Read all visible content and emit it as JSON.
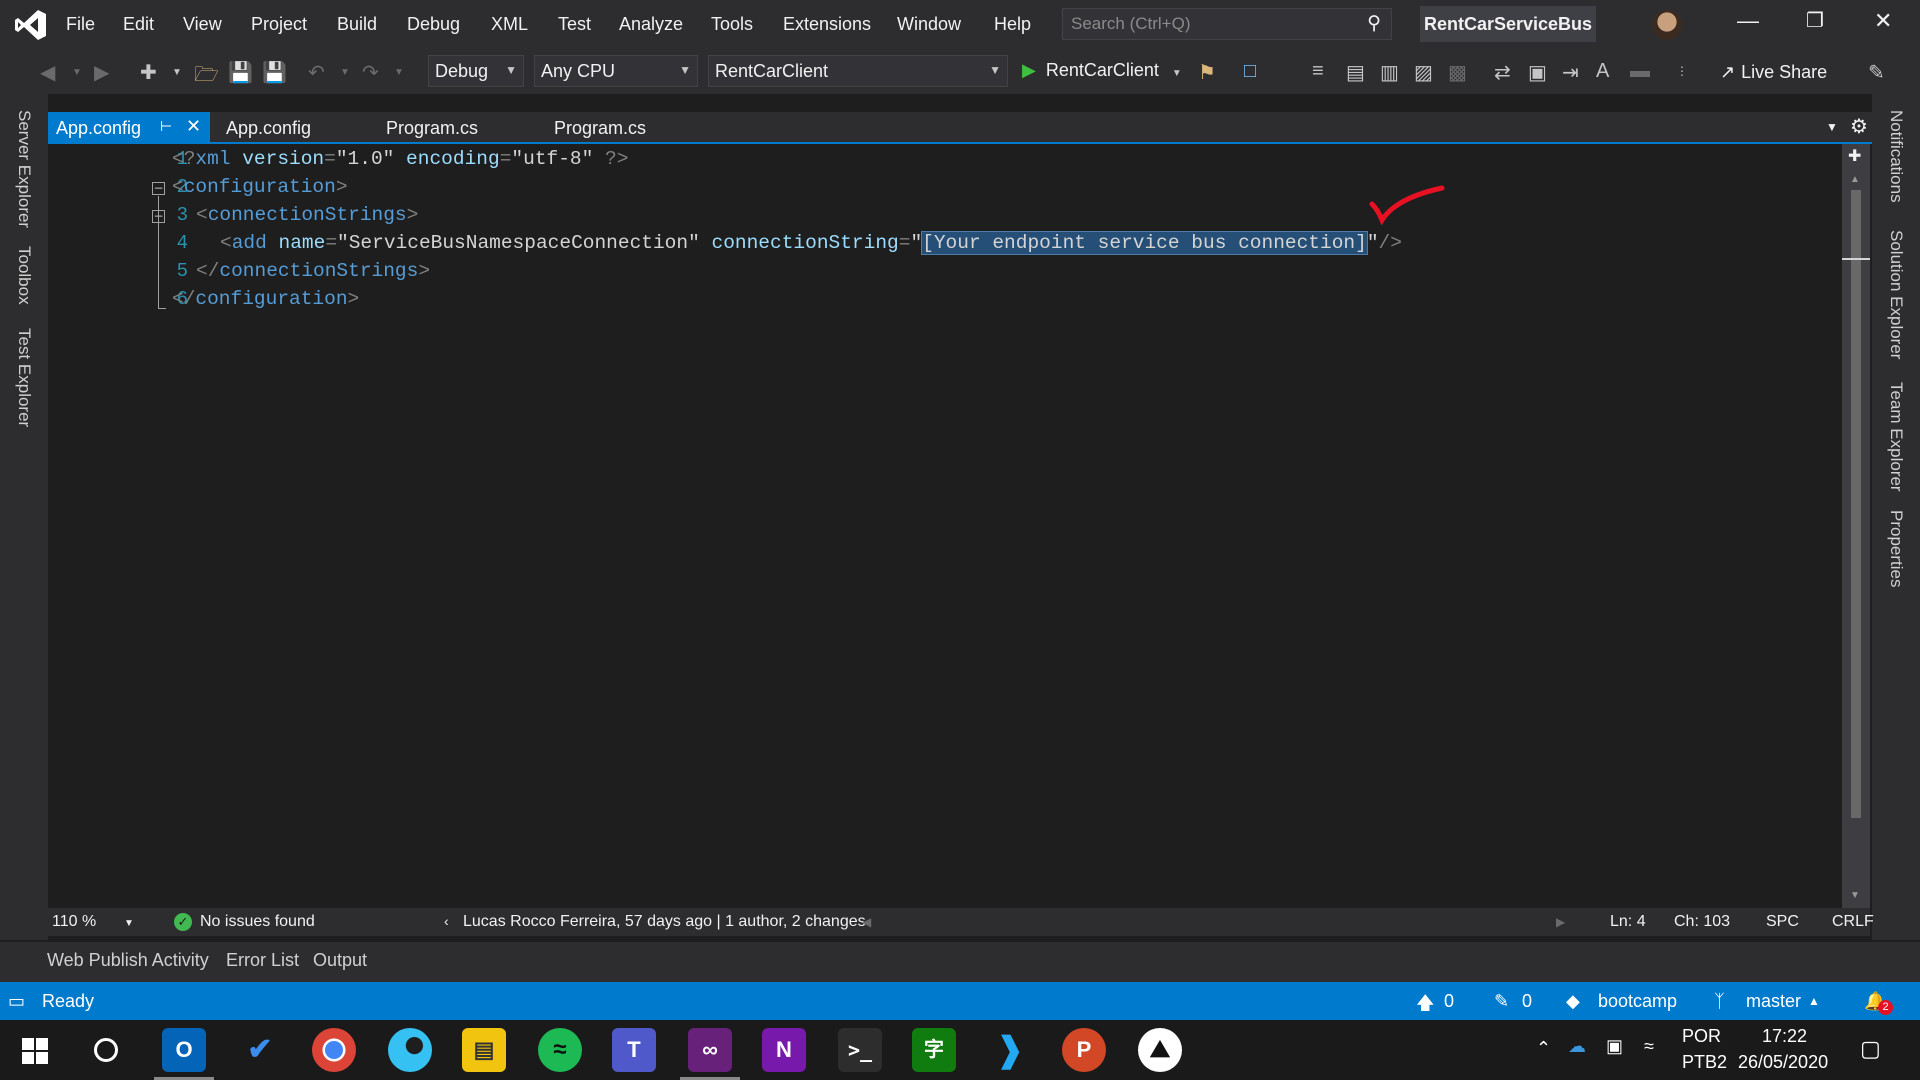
{
  "menubar": {
    "items": [
      "File",
      "Edit",
      "View",
      "Project",
      "Build",
      "Debug",
      "XML",
      "Test",
      "Analyze",
      "Tools",
      "Extensions",
      "Window",
      "Help"
    ],
    "search_placeholder": "Search (Ctrl+Q)",
    "solution_name": "RentCarServiceBus"
  },
  "toolbar": {
    "config": "Debug",
    "platform": "Any CPU",
    "startup_project": "RentCarClient",
    "run_label": "RentCarClient",
    "live_share": "Live Share"
  },
  "left_rail": [
    "Server Explorer",
    "Toolbox",
    "Test Explorer"
  ],
  "right_rail": [
    "Notifications",
    "Solution Explorer",
    "Team Explorer",
    "Properties"
  ],
  "tabs": [
    {
      "label": "App.config",
      "active": true
    },
    {
      "label": "App.config",
      "active": false
    },
    {
      "label": "Program.cs",
      "active": false
    },
    {
      "label": "Program.cs",
      "active": false
    }
  ],
  "code": {
    "line_numbers": [
      "1",
      "2",
      "3",
      "4",
      "5",
      "6"
    ],
    "l1": {
      "open": "<?",
      "tag": "xml",
      "a1": " version",
      "eq1": "=",
      "v1": "\"1.0\"",
      "a2": " encoding",
      "eq2": "=",
      "v2": "\"utf-8\"",
      "close": " ?>"
    },
    "l2": {
      "open": "<",
      "tag": "configuration",
      "close": ">"
    },
    "l3": {
      "open": "<",
      "tag": "connectionStrings",
      "close": ">"
    },
    "l4": {
      "open": "<",
      "tag": "add",
      "a1": " name",
      "eq1": "=",
      "v1": "\"ServiceBusNamespaceConnection\"",
      "a2": " connectionString",
      "eq2": "=",
      "q1": "\"",
      "sel": "[Your endpoint service bus connection]",
      "q2": "\"",
      "close": "/>"
    },
    "l5": {
      "open": "</",
      "tag": "connectionStrings",
      "close": ">"
    },
    "l6": {
      "open": "</",
      "tag": "configuration",
      "close": ">"
    }
  },
  "editor_status": {
    "zoom": "110 %",
    "issues": "No issues found",
    "blame": "Lucas Rocco Ferreira, 57 days ago | 1 author, 2 changes",
    "ln": "Ln: 4",
    "ch": "Ch: 103",
    "spc": "SPC",
    "eol": "CRLF"
  },
  "panel_tabs": [
    "Web Publish Activity",
    "Error List",
    "Output"
  ],
  "statusbar": {
    "ready": "Ready",
    "up_count": "0",
    "pencil_count": "0",
    "repo": "bootcamp",
    "branch": "master",
    "notif_count": "2"
  },
  "tray": {
    "lang1": "POR",
    "lang2": "PTB2",
    "time": "17:22",
    "date": "26/05/2020"
  },
  "colors": {
    "accent": "#007acc",
    "selection": "#264f78",
    "check_mark": "#e81123"
  }
}
